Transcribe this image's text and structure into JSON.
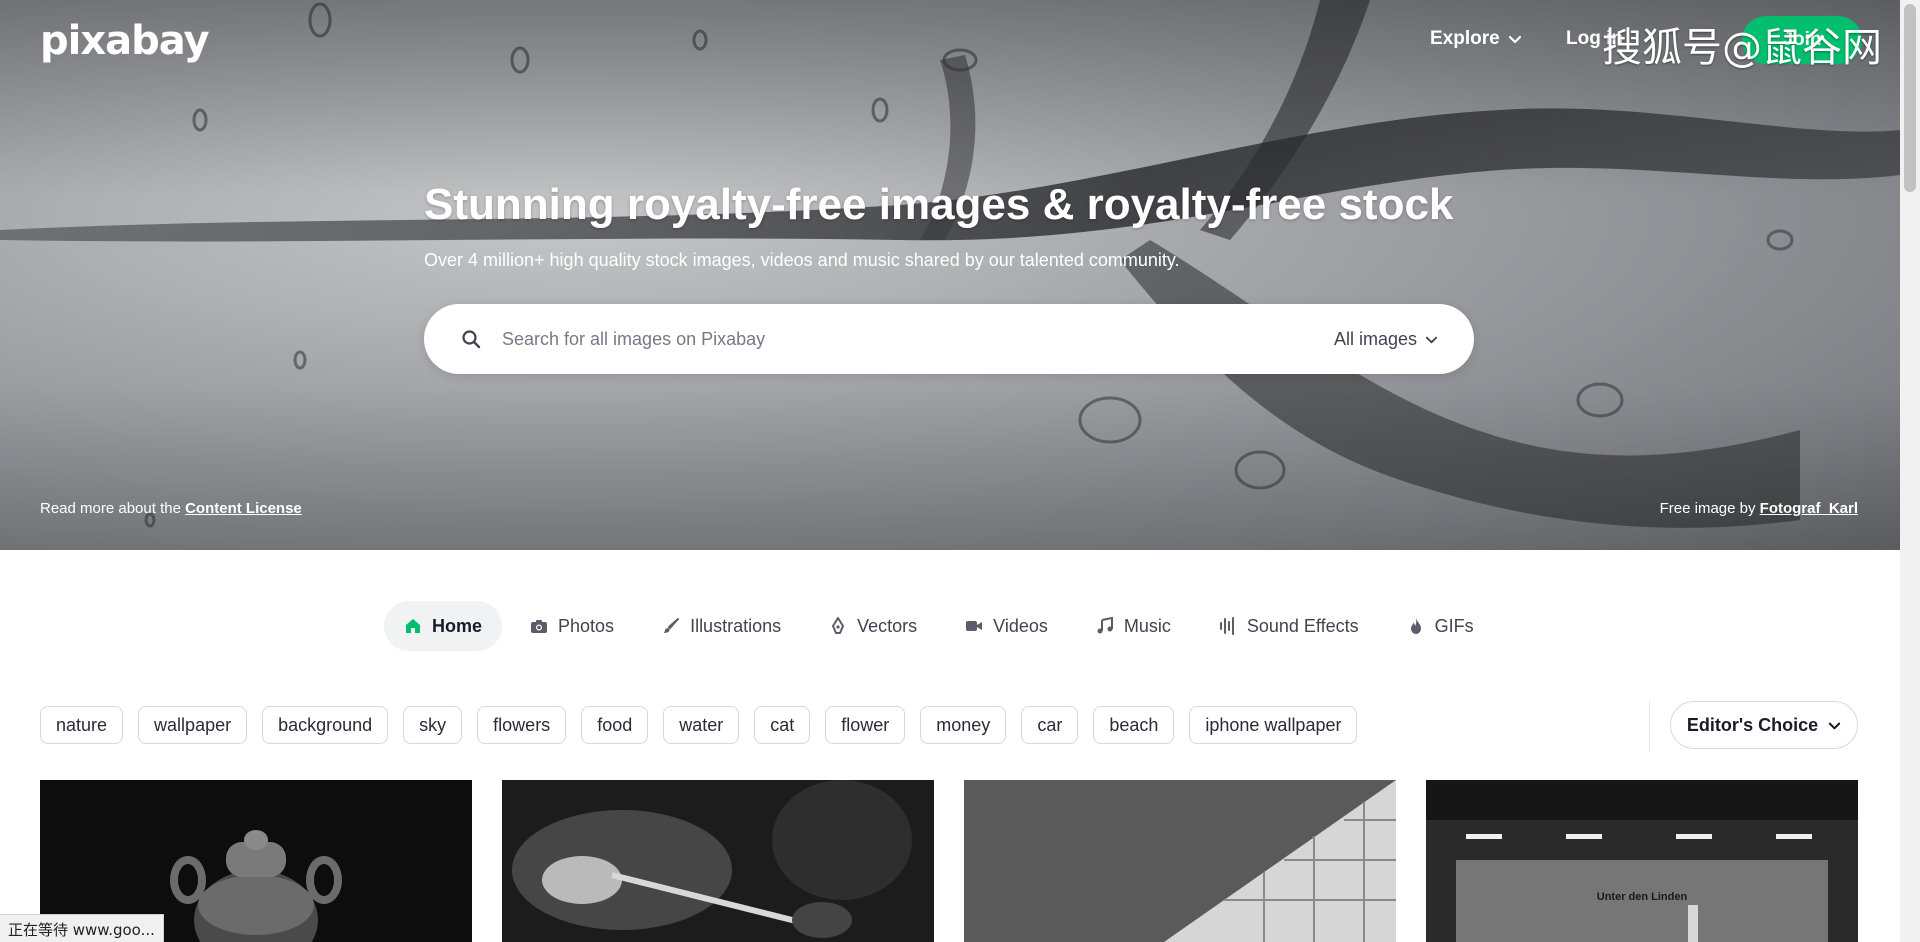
{
  "header": {
    "logo": "pixabay",
    "explore_label": "Explore",
    "login_label": "Log in",
    "join_label": "Join",
    "watermark": "搜狐号@鼠谷网"
  },
  "hero": {
    "title": "Stunning royalty-free images & royalty-free stock",
    "subtitle": "Over 4 million+ high quality stock images, videos and music shared by our talented community.",
    "search_placeholder": "Search for all images on Pixabay",
    "search_type": "All images",
    "license_prefix": "Read more about the ",
    "license_link": "Content License",
    "credit_prefix": "Free image by ",
    "credit_link": "Fotograf_Karl"
  },
  "tabs": [
    {
      "label": "Home",
      "icon": "home-icon",
      "active": true
    },
    {
      "label": "Photos",
      "icon": "camera-icon"
    },
    {
      "label": "Illustrations",
      "icon": "brush-icon"
    },
    {
      "label": "Vectors",
      "icon": "pen-nib-icon"
    },
    {
      "label": "Videos",
      "icon": "video-camera-icon"
    },
    {
      "label": "Music",
      "icon": "music-note-icon"
    },
    {
      "label": "Sound Effects",
      "icon": "sound-wave-icon"
    },
    {
      "label": "GIFs",
      "icon": "flame-icon"
    }
  ],
  "tags": [
    "nature",
    "wallpaper",
    "background",
    "sky",
    "flowers",
    "food",
    "water",
    "cat",
    "flower",
    "money",
    "car",
    "beach",
    "iphone wallpaper"
  ],
  "filter": {
    "editors_choice_label": "Editor's Choice"
  },
  "images": [
    {
      "subject": "teapot"
    },
    {
      "subject": "ladle with steam"
    },
    {
      "subject": "building facade"
    },
    {
      "subject": "subway station",
      "sign_text": "Unter den Linden"
    }
  ],
  "status_bar": {
    "text": "正在等待 www.goo..."
  },
  "colors": {
    "accent": "#02be6e",
    "text": "#191b26",
    "muted": "#414450"
  }
}
